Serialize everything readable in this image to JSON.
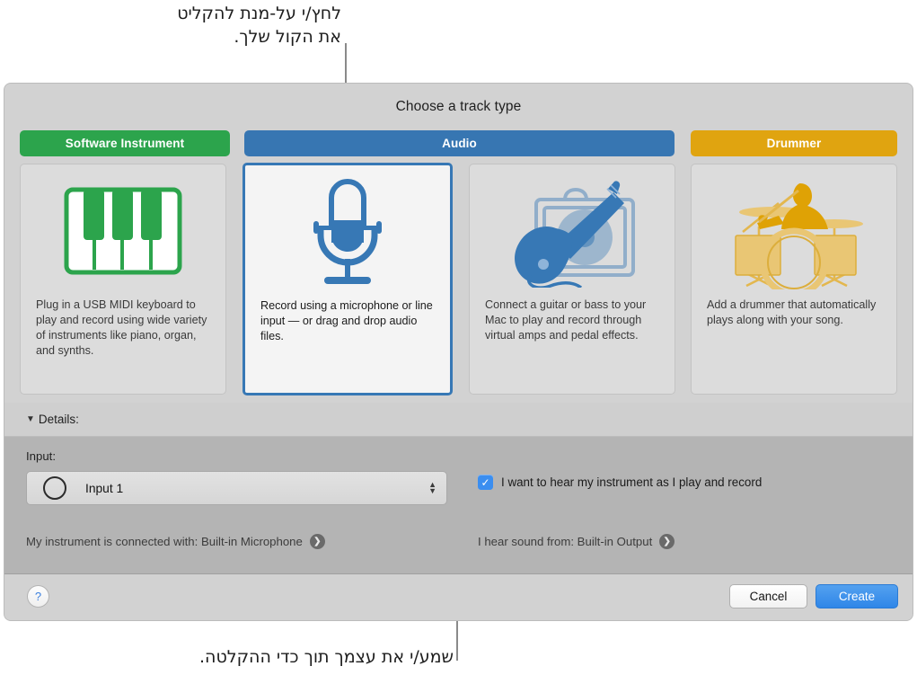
{
  "callouts": {
    "top": "לחץ/י על-מנת להקליט\nאת הקול שלך.",
    "bottom": "שמע/י את עצמך תוך כדי ההקלטה."
  },
  "dialog": {
    "title": "Choose a track type",
    "tabs": [
      {
        "id": "software-instrument",
        "label": "Software Instrument",
        "color": "#2ca44c"
      },
      {
        "id": "audio",
        "label": "Audio",
        "color": "#3776b2",
        "selected": true
      },
      {
        "id": "drummer",
        "label": "Drummer",
        "color": "#e0a410"
      }
    ],
    "cards": [
      {
        "id": "software-instrument",
        "icon": "piano-keyboard-icon",
        "description": "Plug in a USB MIDI keyboard to play and record using wide variety of instruments like piano, organ, and synths.",
        "selected": false
      },
      {
        "id": "audio",
        "icon": "microphone-icon",
        "description": "Record using a microphone or line input — or drag and drop audio files.",
        "selected": true
      },
      {
        "id": "guitar-bass",
        "icon": "guitar-amp-icon",
        "description": "Connect a guitar or bass to your Mac to play and record through virtual amps and pedal effects.",
        "selected": false
      },
      {
        "id": "drummer",
        "icon": "drummer-icon",
        "description": "Add a drummer that automatically plays along with your song.",
        "selected": false
      }
    ],
    "details": {
      "disclosure_glyph": "▼",
      "label": "Details:"
    },
    "settings": {
      "input_label": "Input:",
      "input_value": "Input 1",
      "hear_checkbox_label": "I want to hear my instrument as I play and record",
      "hear_checkbox_checked": true,
      "check_glyph": "✓",
      "connected_with": "My instrument is connected with: Built-in Microphone",
      "hear_sound_from": "I hear sound from: Built-in Output",
      "arrow_glyph": "❯"
    },
    "footer": {
      "help_label": "?",
      "cancel_label": "Cancel",
      "create_label": "Create"
    }
  }
}
